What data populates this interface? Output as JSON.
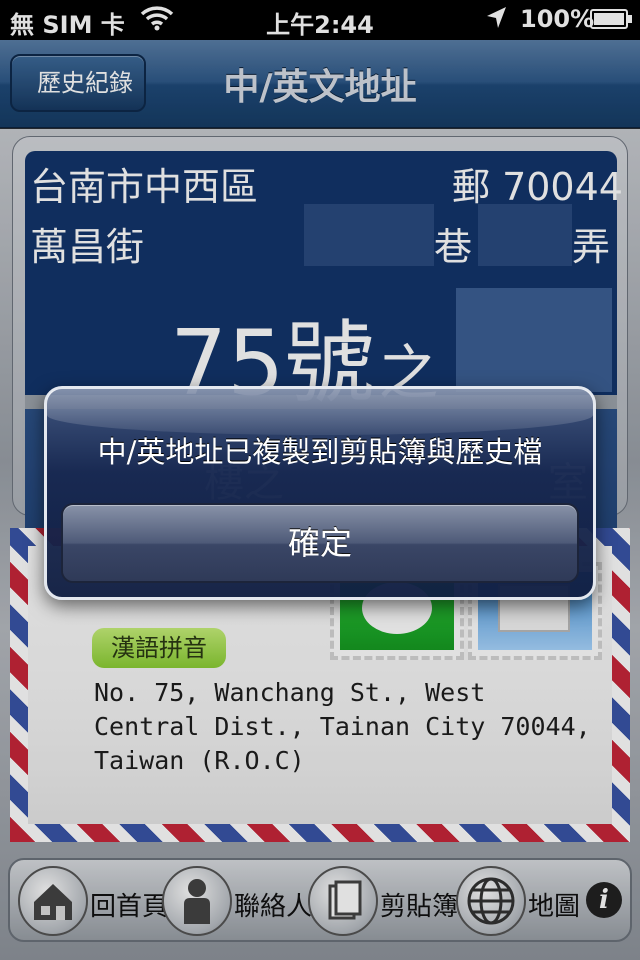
{
  "status_bar": {
    "carrier": "無 SIM 卡",
    "time": "上午2:44",
    "battery": "100%"
  },
  "nav": {
    "back_label": "歷史紀錄",
    "title": "中/英文地址"
  },
  "address": {
    "city_district": "台南市中西區",
    "postal": "郵 70044",
    "street": "萬昌街",
    "lane": "巷",
    "alley": "弄",
    "number": "75號",
    "number_suffix": "之",
    "floor": "樓之",
    "room": "室"
  },
  "envelope": {
    "pinyin_label": "漢語拼音",
    "english_address": "No. 75, Wanchang St., West Central Dist., Tainan City 70044, Taiwan (R.O.C)"
  },
  "toolbar": {
    "home_label": "回首頁",
    "contacts_label": "聯絡人",
    "clipboard_label": "剪貼簿",
    "map_label": "地圖"
  },
  "alert": {
    "message": "中/英地址已複製到剪貼簿與歷史檔",
    "ok_label": "確定"
  },
  "colors": {
    "nav_blue": "#2f5a8a",
    "card_navy": "#13356b",
    "badge_green": "#8ccf34",
    "stripe_red": "#c8263a",
    "stripe_blue": "#3a55a8"
  }
}
